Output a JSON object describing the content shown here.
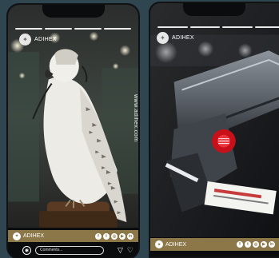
{
  "brand": {
    "name": "ADIHEX",
    "url": "www.adihex.com"
  },
  "comment": {
    "placeholder": "Comments..."
  },
  "icons": {
    "camera": "camera-icon",
    "send": "send-icon",
    "heart": "heart-icon",
    "social": [
      "facebook-icon",
      "twitter-icon",
      "instagram-icon",
      "youtube-icon",
      "linkedin-icon"
    ]
  },
  "social_glyphs": [
    "f",
    "t",
    "◎",
    "▶",
    "in"
  ],
  "story_progress_segments": 4,
  "colors": {
    "footer": "#8b7748",
    "frame": "#0b0c0e",
    "background": "#2f4550"
  }
}
